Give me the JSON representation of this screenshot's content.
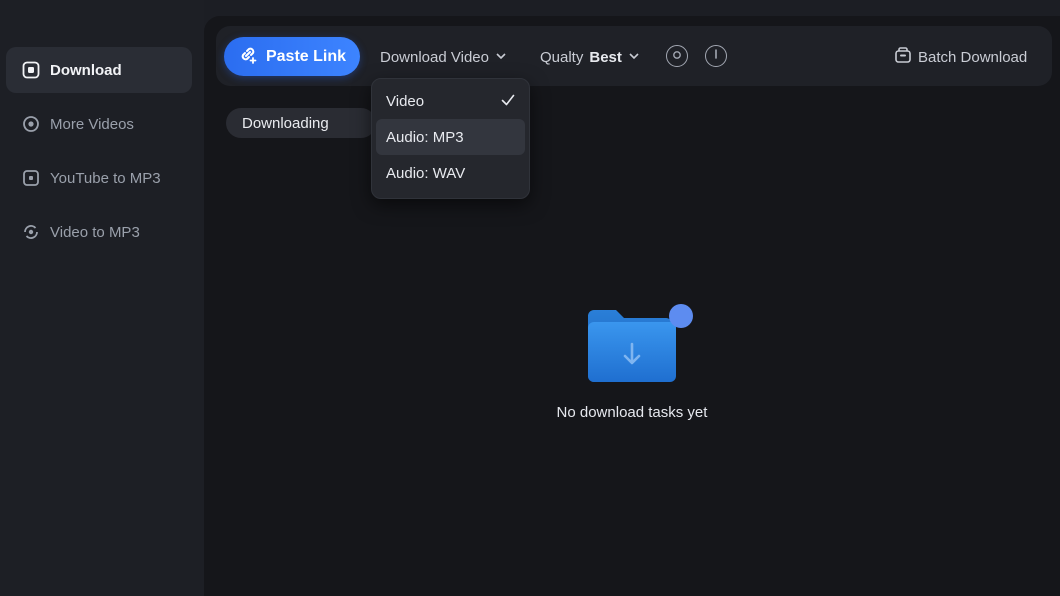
{
  "sidebar": {
    "items": [
      {
        "label": "Download",
        "icon": "download-box-icon",
        "active": true
      },
      {
        "label": "More Videos",
        "icon": "circle-icon",
        "active": false
      },
      {
        "label": "YouTube to MP3",
        "icon": "square-music-icon",
        "active": false
      },
      {
        "label": "Video to MP3",
        "icon": "convert-icon",
        "active": false
      }
    ]
  },
  "toolbar": {
    "paste_label": "Paste Link",
    "download_label": "Download Video",
    "quality_prefix": "Qualty",
    "quality_value": "Best",
    "batch_label": "Batch Download"
  },
  "tabs": {
    "downloading": "Downloading"
  },
  "dropdown": {
    "options": [
      {
        "label": "Video",
        "selected": true
      },
      {
        "label": "Audio: MP3",
        "selected": false
      },
      {
        "label": "Audio: WAV",
        "selected": false
      }
    ]
  },
  "empty": {
    "message": "No download tasks yet"
  },
  "colors": {
    "accent": "#2b6df0",
    "folder": "#2f86e0",
    "badge": "#5d8cf0"
  }
}
